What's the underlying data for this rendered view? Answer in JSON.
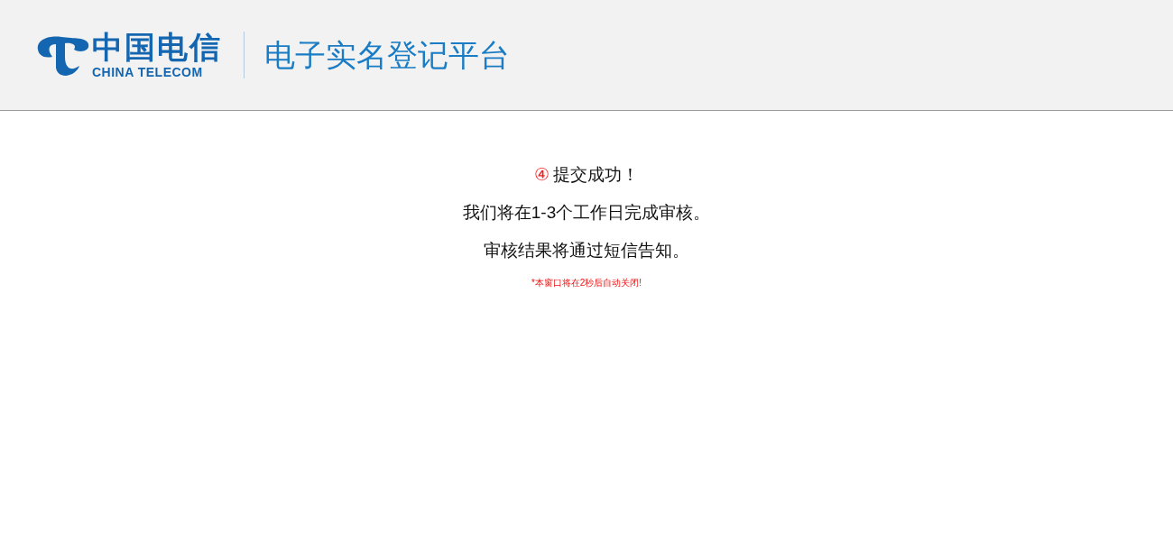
{
  "header": {
    "logo_cn": "中国电信",
    "logo_en": "CHINA TELECOM",
    "platform_title": "电子实名登记平台"
  },
  "result": {
    "step": "④",
    "title": "提交成功！",
    "lines": [
      "我们将在1-3个工作日完成审核。",
      "审核结果将通过短信告知。"
    ],
    "notice": "*本窗口将在2秒后自动关闭!"
  }
}
